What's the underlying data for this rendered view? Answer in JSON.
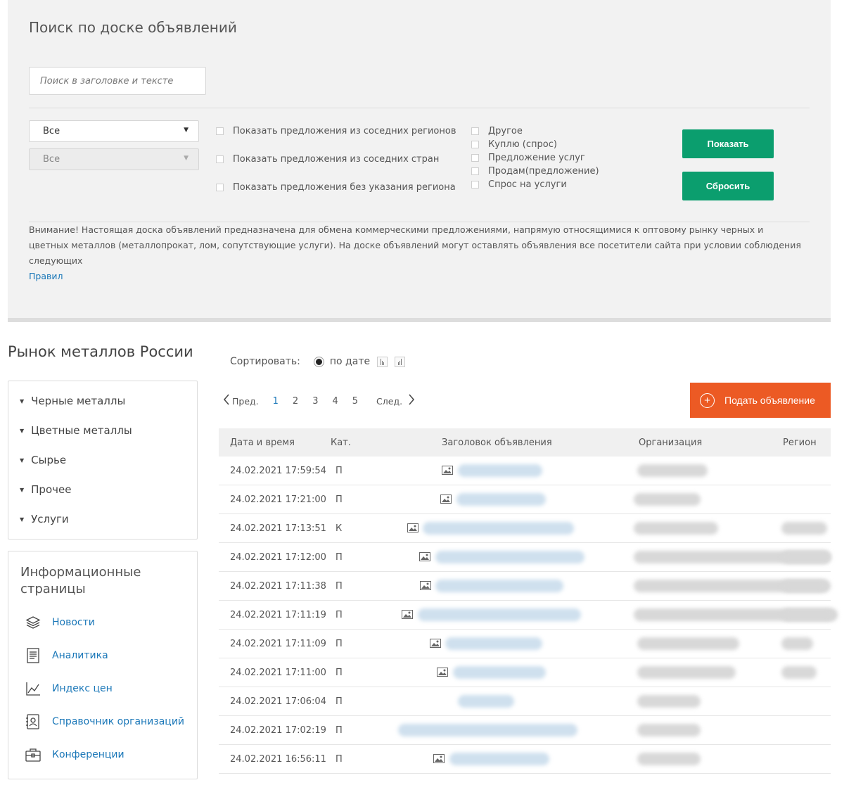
{
  "search": {
    "title": "Поиск по доске объявлений",
    "placeholder": "Поиск в заголовке и тексте",
    "select1": "Все",
    "select2": "Все",
    "region_options": [
      "Показать предложения из соседних регионов",
      "Показать предложения из соседних стран",
      "Показать предложения без указания региона"
    ],
    "type_options": [
      "Другое",
      "Куплю (спрос)",
      "Предложение услуг",
      "Продам(предложение)",
      "Спрос на услуги"
    ],
    "show_button": "Показать",
    "reset_button": "Сбросить",
    "notice": "Внимание! Настоящая доска объявлений предназначена для обмена коммерческими предложениями, напрямую относящимися к оптовому рынку черных и цветных металлов (металлопрокат, лом, сопутствующие услуги). На доске объявлений могут оставлять объявления все посетители сайта при условии соблюдения следующих",
    "notice_link": "Правил"
  },
  "sidebar": {
    "market_title": "Рынок металлов России",
    "categories": [
      "Черные металлы",
      "Цветные металлы",
      "Сырье",
      "Прочее",
      "Услуги"
    ],
    "info_title": "Информационные страницы",
    "info_items": [
      {
        "label": "Новости",
        "icon": "layers-icon"
      },
      {
        "label": "Аналитика",
        "icon": "document-icon"
      },
      {
        "label": "Индекс цен",
        "icon": "chart-icon"
      },
      {
        "label": "Справочник организаций",
        "icon": "contacts-book-icon"
      },
      {
        "label": "Конференции",
        "icon": "briefcase-icon"
      }
    ]
  },
  "sort": {
    "label": "Сортировать:",
    "by_date": "по дате"
  },
  "pager": {
    "prev": "Пред.",
    "next": "След.",
    "pages": [
      "1",
      "2",
      "3",
      "4",
      "5"
    ],
    "active_page": "1"
  },
  "add_button": "Подать объявление",
  "table": {
    "headers": {
      "date": "Дата и время",
      "cat": "Кат.",
      "title": "Заголовок объявления",
      "org": "Организация",
      "region": "Регион"
    },
    "rows": [
      {
        "date": "24.02.2021 17:59:54",
        "cat": "П"
      },
      {
        "date": "24.02.2021 17:21:00",
        "cat": "П"
      },
      {
        "date": "24.02.2021 17:13:51",
        "cat": "К"
      },
      {
        "date": "24.02.2021 17:12:00",
        "cat": "П"
      },
      {
        "date": "24.02.2021 17:11:38",
        "cat": "П"
      },
      {
        "date": "24.02.2021 17:11:19",
        "cat": "П"
      },
      {
        "date": "24.02.2021 17:11:09",
        "cat": "П"
      },
      {
        "date": "24.02.2021 17:11:00",
        "cat": "П"
      },
      {
        "date": "24.02.2021 17:06:04",
        "cat": "П"
      },
      {
        "date": "24.02.2021 17:02:19",
        "cat": "П"
      },
      {
        "date": "24.02.2021 16:56:11",
        "cat": "П"
      }
    ]
  },
  "colors": {
    "green": "#0b9e6e",
    "orange": "#ec5a24",
    "link": "#1a77b8"
  }
}
